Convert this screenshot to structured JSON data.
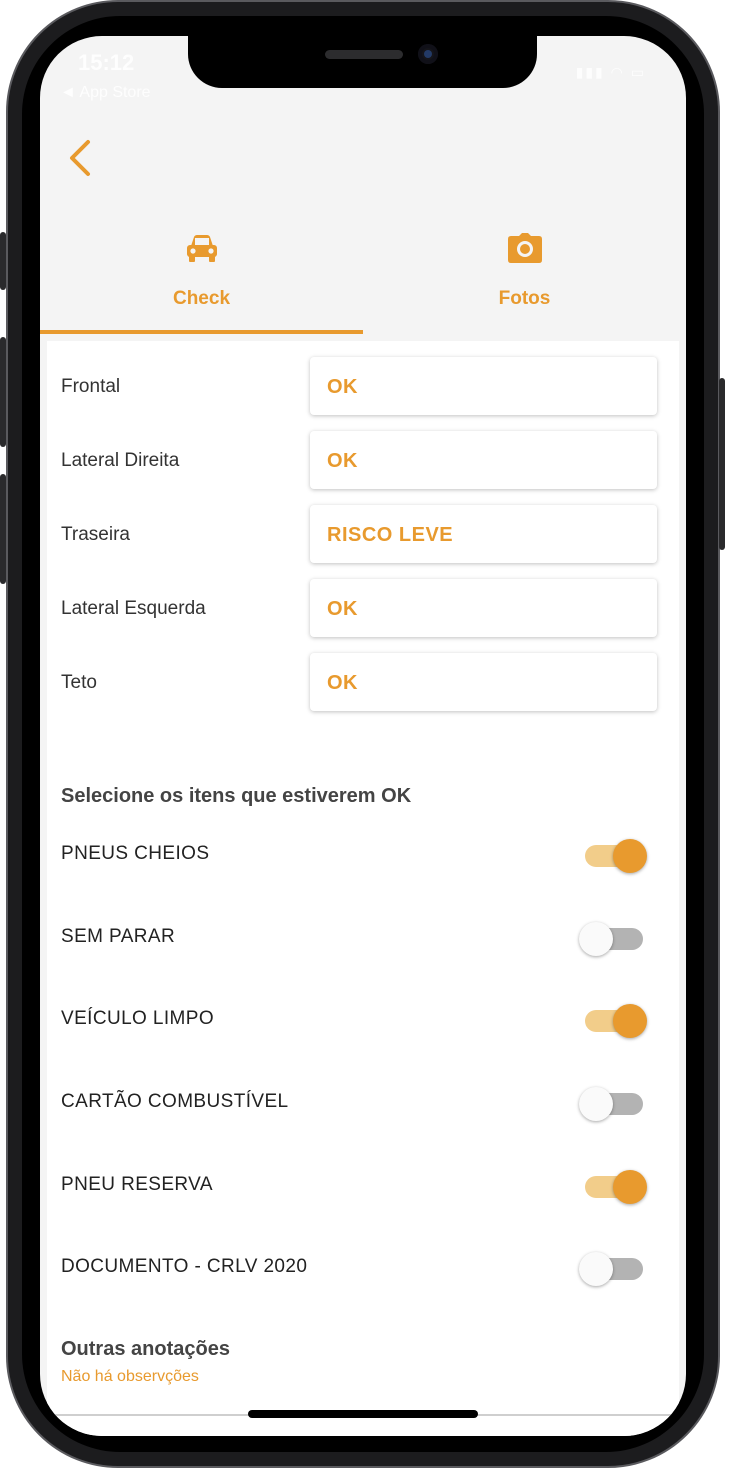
{
  "status_bar": {
    "time": "15:12",
    "back_app": "◄ App Store"
  },
  "nav": {
    "back_icon": "chevron-left-icon"
  },
  "tabs": [
    {
      "label": "Check",
      "icon": "car-icon",
      "active": true
    },
    {
      "label": "Fotos",
      "icon": "camera-icon",
      "active": false
    }
  ],
  "inspection": [
    {
      "label": "Frontal",
      "value": "OK"
    },
    {
      "label": "Lateral Direita",
      "value": "OK"
    },
    {
      "label": "Traseira",
      "value": "RISCO LEVE"
    },
    {
      "label": "Lateral Esquerda",
      "value": "OK"
    },
    {
      "label": "Teto",
      "value": "OK"
    }
  ],
  "checklist": {
    "title": "Selecione os itens que estiverem OK",
    "items": [
      {
        "label": "PNEUS CHEIOS",
        "checked": true
      },
      {
        "label": "SEM PARAR",
        "checked": false
      },
      {
        "label": "VEÍCULO LIMPO",
        "checked": true
      },
      {
        "label": "CARTÃO COMBUSTÍVEL",
        "checked": false
      },
      {
        "label": "PNEU RESERVA",
        "checked": true
      },
      {
        "label": "DOCUMENTO - CRLV 2020",
        "checked": false
      }
    ]
  },
  "notes": {
    "title": "Outras anotações",
    "text": "Não há observções"
  },
  "colors": {
    "accent": "#e89a2e",
    "accent_light": "#f2cd8a",
    "switch_off_track": "#b3b3b3",
    "background": "#f4f4f4"
  }
}
